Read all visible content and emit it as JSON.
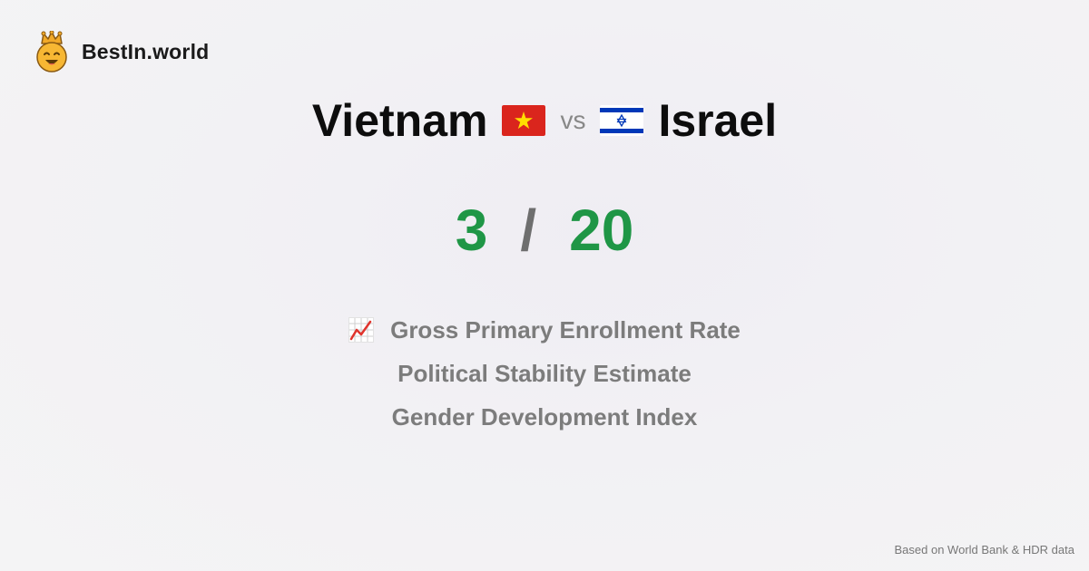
{
  "brand": {
    "name": "BestIn.world",
    "logo_icon": "crowned-smiley-icon"
  },
  "comparison": {
    "left_country": "Vietnam",
    "left_flag": "vietnam-flag-icon",
    "vs_label": "vs",
    "right_country": "Israel",
    "right_flag": "israel-flag-icon"
  },
  "scores": {
    "left": "3",
    "separator": "/",
    "right": "20",
    "color": "#1f9646"
  },
  "metrics": [
    {
      "label": "Gross Primary Enrollment Rate",
      "icon": "chart-increasing-icon"
    },
    {
      "label": "Political Stability Estimate"
    },
    {
      "label": "Gender Development Index"
    }
  ],
  "footer": {
    "source": "Based on World Bank & HDR data"
  }
}
